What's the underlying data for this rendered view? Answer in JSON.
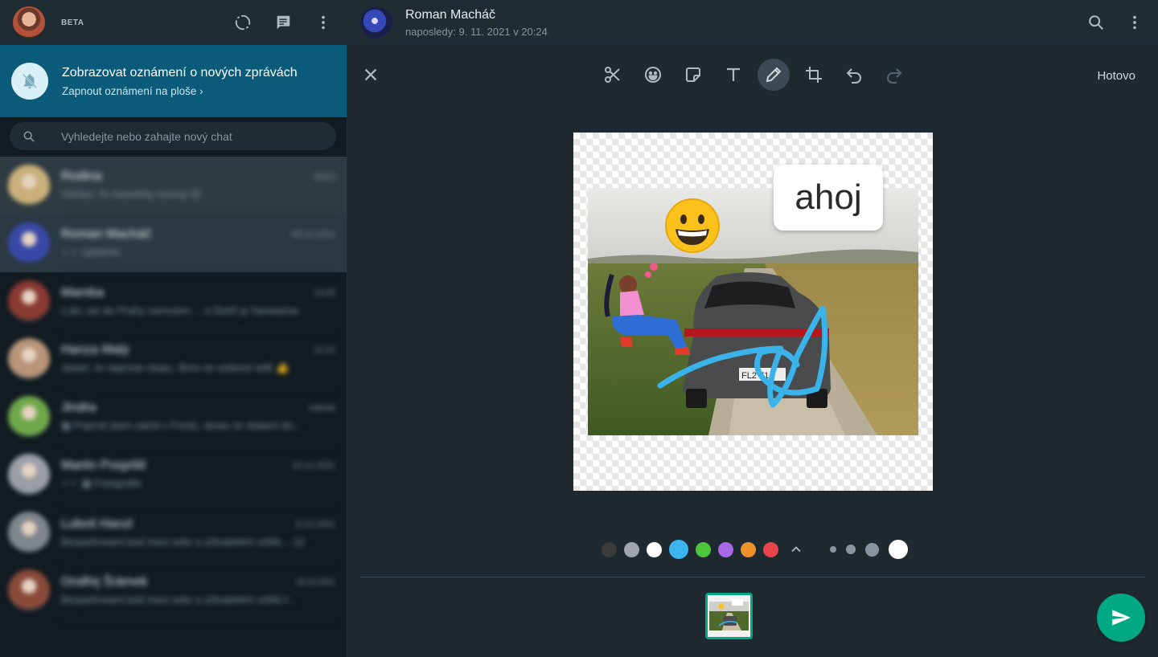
{
  "sidebar": {
    "beta_label": "BETA",
    "notification": {
      "title": "Zobrazovat oznámení o nových zprávách",
      "subtitle": "Zapnout oznámení na ploše ›"
    },
    "search": {
      "placeholder": "Vyhledejte nebo zahajte nový chat"
    },
    "chats": [
      {
        "name": "Rodina",
        "time": "včera",
        "message": "Václav: To maminky rozvoji 😊",
        "avatar_color": "#c9b07a"
      },
      {
        "name": "Roman Macháč",
        "time": "09.11.2021",
        "message": "✓✓ Uplatnie",
        "avatar_color": "#3a49a8"
      },
      {
        "name": "Mamba",
        "time": "14:45",
        "message": "Lubi, asi do Prahy nemusim ... a Dorič je hanetama",
        "avatar_color": "#8a3a32"
      },
      {
        "name": "Hanza Malý",
        "time": "11:02",
        "message": "Jasan, to napnoto stupu. Bros se uzdorai selb 👍",
        "avatar_color": "#b89478"
      },
      {
        "name": "Jindra",
        "time": "sobota",
        "message": "▦ Poprvé jsem zatíst v Fordu, dostu se dobení do...",
        "avatar_color": "#6fa84a"
      },
      {
        "name": "Martin Pospíšil",
        "time": "16.11.2021",
        "message": "✓✓ ▦ Fotografie",
        "avatar_color": "#9a9fa6"
      },
      {
        "name": "Luboš Hanzl",
        "time": "8.10.2021",
        "message": "Bezpečnostní kód mezi sebr a uživatelem vrtičk... 12",
        "avatar_color": "#7f868c"
      },
      {
        "name": "Ondřej Šrámek",
        "time": "30.9.2021",
        "message": "Bezpečnostní kód mezi sebr a uživatelem vrtičk f...",
        "avatar_color": "#8a4a3a"
      }
    ]
  },
  "chat_header": {
    "name": "Roman Macháč",
    "status": "naposledy: 9. 11. 2021 v 20:24"
  },
  "editor": {
    "done_label": "Hotovo",
    "text_sticker": "ahoj",
    "tools": [
      "scissors-icon",
      "emoji-icon",
      "sticker-icon",
      "text-icon",
      "pencil-icon",
      "crop-icon",
      "undo-icon",
      "redo-icon"
    ],
    "active_tool": "pencil-icon",
    "colors": [
      "#3b3b3b",
      "#a0a4ab",
      "#ffffff",
      "#3bb5f0",
      "#4cc63a",
      "#a868e8",
      "#f0922a",
      "#e8454a"
    ],
    "selected_color": "#3bb5f0",
    "brush_sizes": [
      "small",
      "medium",
      "large",
      "extra-large"
    ],
    "selected_brush": "extra-large"
  }
}
